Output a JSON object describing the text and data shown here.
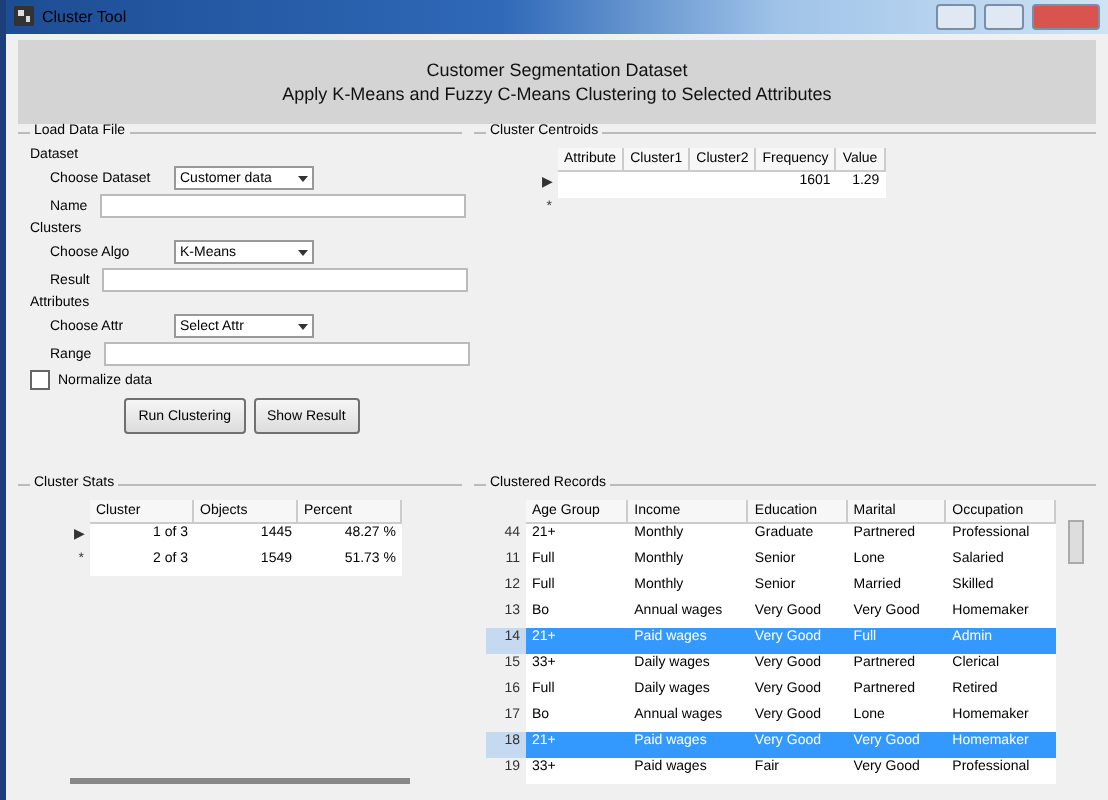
{
  "window": {
    "title": "Cluster Tool"
  },
  "header": {
    "line_1": "Customer Segmentation Dataset",
    "line_2": "Apply K-Means and Fuzzy C-Means Clustering to Selected Attributes"
  },
  "load_panel": {
    "title": "Load Data File",
    "sections": [
      {
        "heading": "Dataset",
        "fields": [
          {
            "kind": "select",
            "label": "Choose Dataset",
            "value": "Customer data"
          },
          {
            "kind": "text",
            "label": "Name"
          }
        ]
      },
      {
        "heading": "Clusters",
        "fields": [
          {
            "kind": "select",
            "label": "Choose Algo",
            "value": "K-Means"
          },
          {
            "kind": "text",
            "label": "Result"
          }
        ]
      },
      {
        "heading": "Attributes",
        "fields": [
          {
            "kind": "select",
            "label": "Choose Attr",
            "value": "Select Attr"
          },
          {
            "kind": "text",
            "label": "Range"
          }
        ]
      }
    ],
    "checkbox": {
      "label": "Normalize data",
      "checked": false
    },
    "buttons": [
      "Run Clustering",
      "Show Result"
    ]
  },
  "centroids": {
    "title": "Cluster Centroids",
    "columns": [
      "Attribute",
      "Cluster1",
      "Cluster2",
      "Frequency",
      "Value"
    ],
    "rows": [
      {
        "marker": "▶",
        "cells": [
          "",
          "",
          "",
          "1601",
          "1.29"
        ]
      },
      {
        "marker": "*"
      }
    ]
  },
  "stats": {
    "title": "Cluster Stats",
    "columns": [
      "Cluster",
      "Objects",
      "Percent"
    ],
    "rows": [
      {
        "marker": "▶",
        "cells": [
          "1 of 3",
          "1445",
          "48.27 %"
        ]
      },
      {
        "marker": "*",
        "cells": [
          "2 of 3",
          "1549",
          "51.73 %"
        ]
      }
    ]
  },
  "records": {
    "title": "Clustered Records",
    "columns": [
      "Age Group",
      "Income",
      "Education",
      "Marital",
      "Occupation"
    ],
    "rows": [
      {
        "marker": "44",
        "selected": false,
        "cells": [
          "21+",
          "Monthly",
          "Graduate",
          "Partnered",
          "Professional"
        ]
      },
      {
        "marker": "11",
        "selected": false,
        "cells": [
          "Full",
          "Monthly",
          "Senior",
          "Lone",
          "Salaried"
        ]
      },
      {
        "marker": "12",
        "selected": false,
        "cells": [
          "Full",
          "Monthly",
          "Senior",
          "Married",
          "Skilled"
        ]
      },
      {
        "marker": "13",
        "selected": false,
        "cells": [
          "Bo",
          "Annual wages",
          "Very Good",
          "Very Good",
          "Homemaker"
        ]
      },
      {
        "marker": "14",
        "selected": true,
        "cells": [
          "21+",
          "Paid wages",
          "Very Good",
          "Full",
          "Admin"
        ]
      },
      {
        "marker": "15",
        "selected": false,
        "cells": [
          "33+",
          "Daily wages",
          "Very Good",
          "Partnered",
          "Clerical"
        ]
      },
      {
        "marker": "16",
        "selected": false,
        "cells": [
          "Full",
          "Daily wages",
          "Very Good",
          "Partnered",
          "Retired"
        ]
      },
      {
        "marker": "17",
        "selected": false,
        "cells": [
          "Bo",
          "Annual wages",
          "Very Good",
          "Lone",
          "Homemaker"
        ]
      },
      {
        "marker": "18",
        "selected": true,
        "cells": [
          "21+",
          "Paid wages",
          "Very Good",
          "Very Good",
          "Homemaker"
        ]
      },
      {
        "marker": "19",
        "selected": false,
        "cells": [
          "33+",
          "Paid wages",
          "Fair",
          "Very Good",
          "Professional"
        ]
      }
    ]
  }
}
